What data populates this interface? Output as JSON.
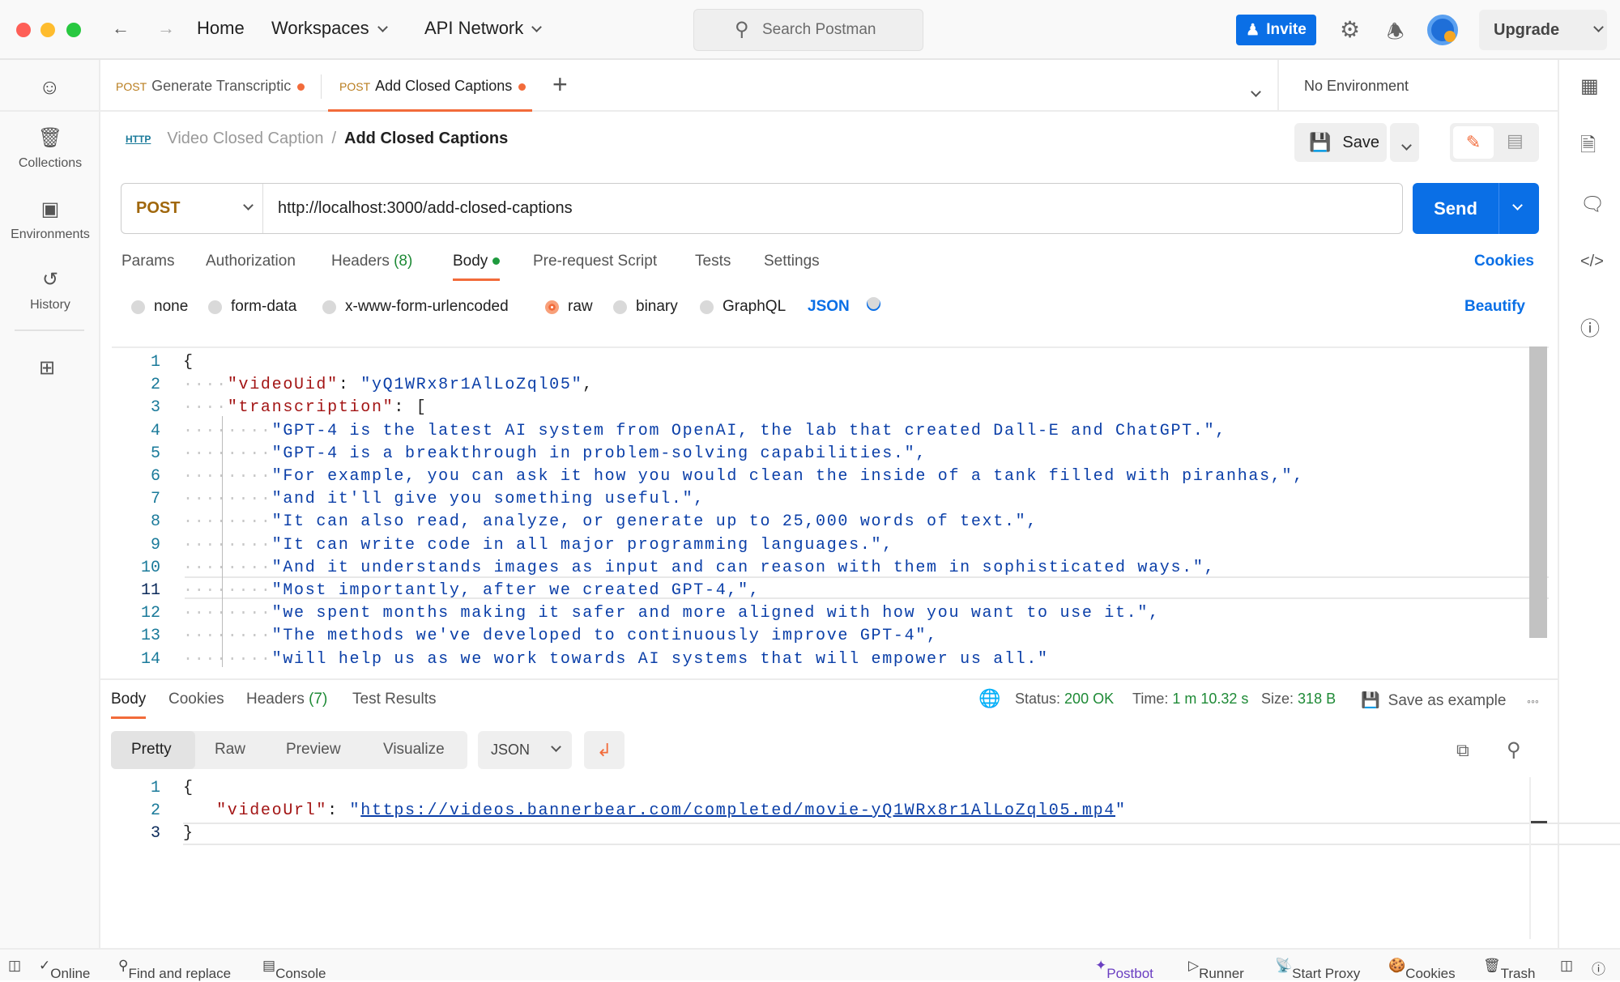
{
  "titlebar": {
    "home": "Home",
    "workspaces": "Workspaces",
    "api_network": "API Network",
    "search_placeholder": "Search Postman",
    "invite": "Invite",
    "upgrade": "Upgrade"
  },
  "sidebar": {
    "items": [
      {
        "label": "Collections",
        "icon": "collections-icon"
      },
      {
        "label": "Environments",
        "icon": "environments-icon"
      },
      {
        "label": "History",
        "icon": "history-icon"
      }
    ]
  },
  "tabs": [
    {
      "method": "POST",
      "label": "Generate Transcriptic"
    },
    {
      "method": "POST",
      "label": "Add Closed Captions"
    }
  ],
  "environment": "No Environment",
  "breadcrumb": {
    "icon": "HTTP",
    "parent": "Video Closed Caption",
    "sep": "/",
    "current": "Add Closed Captions"
  },
  "save": "Save",
  "request": {
    "method": "POST",
    "url": "http://localhost:3000/add-closed-captions",
    "send": "Send"
  },
  "request_tabs": [
    "Params",
    "Authorization",
    "Headers",
    "(8)",
    "Body",
    "Pre-request Script",
    "Tests",
    "Settings"
  ],
  "cookies": "Cookies",
  "body_types": [
    "none",
    "form-data",
    "x-www-form-urlencoded",
    "raw",
    "binary",
    "GraphQL"
  ],
  "body_selected": "raw",
  "body_format": "JSON",
  "beautify": "Beautify",
  "request_body": {
    "key1": "\"videoUid\"",
    "val1": "\"yQ1WRx8r1AlLoZql05\"",
    "key2": "\"transcription\"",
    "lines": [
      "\"GPT-4 is the latest AI system from OpenAI, the lab that created Dall-E and ChatGPT.\",",
      "\"GPT-4 is a breakthrough in problem-solving capabilities.\",",
      "\"For example, you can ask it how you would clean the inside of a tank filled with piranhas,\",",
      "\"and it'll give you something useful.\",",
      "\"It can also read, analyze, or generate up to 25,000 words of text.\",",
      "\"It can write code in all major programming languages.\",",
      "\"And it understands images as input and can reason with them in sophisticated ways.\",",
      "\"Most importantly, after we created GPT-4,\",",
      "\"we spent months making it safer and more aligned with how you want to use it.\",",
      "\"The methods we've developed to continuously improve GPT-4\",",
      "\"will help us as we work towards AI systems that will empower us all.\""
    ]
  },
  "response_tabs": [
    "Body",
    "Cookies",
    "Headers",
    "(7)",
    "Test Results"
  ],
  "response_meta": {
    "status_label": "Status:",
    "status": "200 OK",
    "time_label": "Time:",
    "time": "1 m 10.32 s",
    "size_label": "Size:",
    "size": "318 B",
    "save_example": "Save as example"
  },
  "response_views": [
    "Pretty",
    "Raw",
    "Preview",
    "Visualize"
  ],
  "response_format": "JSON",
  "response_body": {
    "key": "\"videoUrl\"",
    "url": "https://videos.bannerbear.com/completed/movie-yQ1WRx8r1AlLoZql05.mp4"
  },
  "statusbar": {
    "online": "Online",
    "find": "Find and replace",
    "console": "Console",
    "postbot": "Postbot",
    "runner": "Runner",
    "proxy": "Start Proxy",
    "cookies": "Cookies",
    "trash": "Trash"
  },
  "colors": {
    "accent": "#0a6fe6",
    "active_tab": "#f26b3a",
    "success": "#1e8a36",
    "postbot": "#6b3fc2"
  }
}
